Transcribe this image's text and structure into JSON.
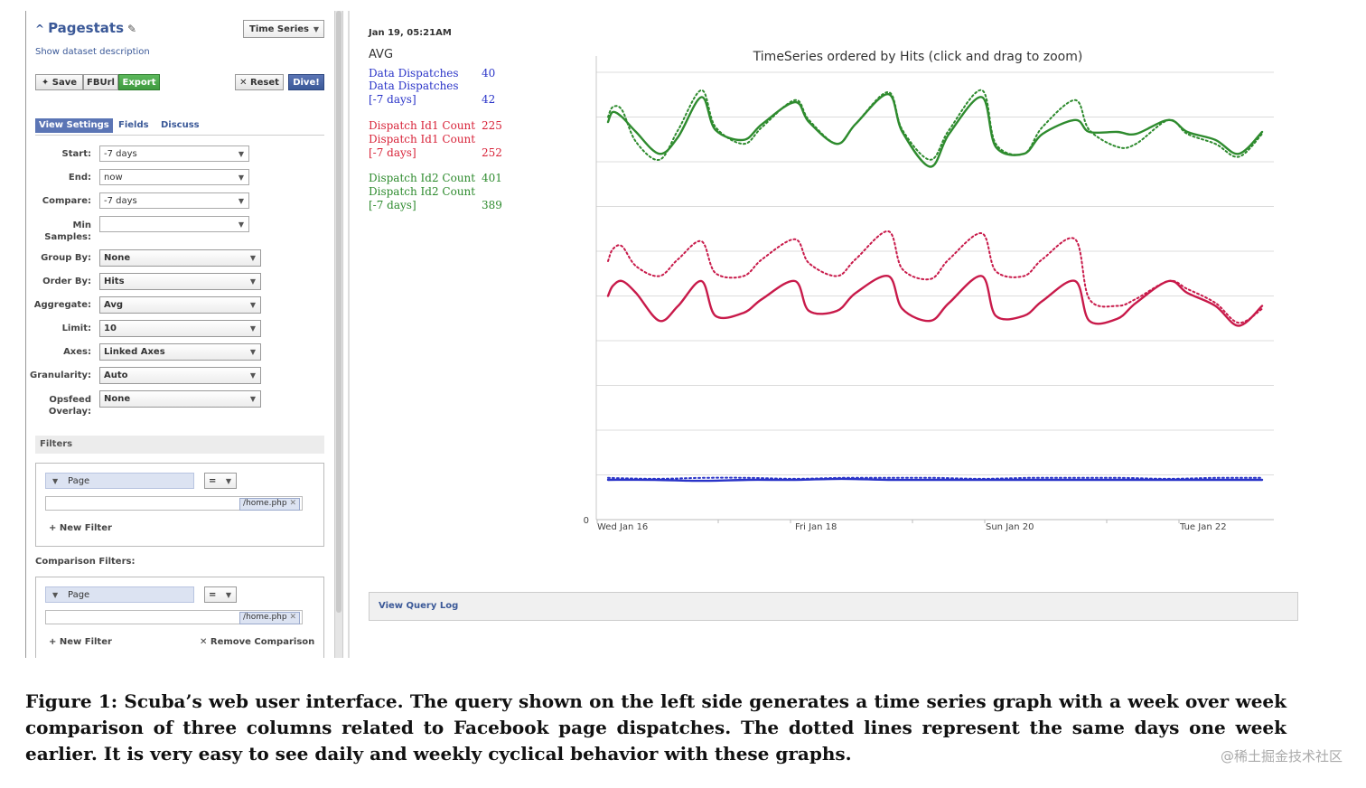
{
  "panel": {
    "title": "Pagestats",
    "show_description": "Show dataset description",
    "view_type": "Time Series",
    "buttons": {
      "save": "Save",
      "fburl": "FBUrl",
      "export": "Export",
      "reset": "Reset",
      "dive": "Dive!"
    },
    "tabs": {
      "view_settings": "View Settings",
      "fields": "Fields",
      "discuss": "Discuss"
    },
    "fields": {
      "start": {
        "label": "Start:",
        "value": "-7 days"
      },
      "end": {
        "label": "End:",
        "value": "now"
      },
      "compare": {
        "label": "Compare:",
        "value": "-7 days"
      },
      "min_samples": {
        "label1": "Min",
        "label2": "Samples:",
        "value": ""
      },
      "group_by": {
        "label": "Group By:",
        "value": "None"
      },
      "order_by": {
        "label": "Order By:",
        "value": "Hits"
      },
      "aggregate": {
        "label": "Aggregate:",
        "value": "Avg"
      },
      "limit": {
        "label": "Limit:",
        "value": "10"
      },
      "axes": {
        "label": "Axes:",
        "value": "Linked Axes"
      },
      "granularity": {
        "label": "Granularity:",
        "value": "Auto"
      },
      "opsfeed": {
        "label1": "Opsfeed",
        "label2": "Overlay:",
        "value": "None"
      }
    },
    "filters": {
      "title": "Filters",
      "field": "Page",
      "operator": "=",
      "token": "/home.php",
      "new_filter": "New Filter"
    },
    "comparison_filters": {
      "title": "Comparison Filters:",
      "field": "Page",
      "operator": "=",
      "token": "/home.php",
      "new_filter": "New Filter",
      "remove": "Remove Comparison"
    }
  },
  "legend": {
    "date": "Jan 19, 05:21AM",
    "aggregate": "AVG",
    "entries": [
      {
        "lines": [
          "Data Dispatches"
        ],
        "value": "40",
        "color": "#2a34c8"
      },
      {
        "lines": [
          "Data Dispatches",
          "[-7 days]"
        ],
        "value": "42",
        "color": "#2a34c8"
      },
      {
        "lines": [
          "Dispatch Id1 Count"
        ],
        "value": "225",
        "color": "#d8243a"
      },
      {
        "lines": [
          "Dispatch Id1 Count",
          "[-7 days]"
        ],
        "value": "252",
        "color": "#d8243a"
      },
      {
        "lines": [
          "Dispatch Id2 Count"
        ],
        "value": "401",
        "color": "#2e8b2e"
      },
      {
        "lines": [
          "Dispatch Id2 Count",
          "[-7 days]"
        ],
        "value": "389",
        "color": "#2e8b2e"
      }
    ]
  },
  "chart_data": {
    "type": "line",
    "title": "TimeSeries ordered by Hits (click and drag to zoom)",
    "x_tick_labels": [
      "Wed Jan 16",
      "Fri Jan 18",
      "Sun Jan 20",
      "Tue Jan 22"
    ],
    "y_tick_labels": [
      "0"
    ],
    "ylim": [
      0,
      450
    ],
    "grid": true,
    "series": [
      {
        "name": "Data Dispatches",
        "color": "#2a34c8",
        "style": "solid",
        "x": [
          0,
          0.5,
          1,
          1.5,
          2,
          2.5,
          3,
          3.5,
          4,
          4.5,
          5,
          5.5,
          6,
          6.5,
          7
        ],
        "y": [
          40,
          40,
          39,
          40,
          40,
          41,
          40,
          40,
          40,
          40,
          40,
          40,
          40,
          40,
          40
        ]
      },
      {
        "name": "Data Dispatches [-7 days]",
        "color": "#2a34c8",
        "style": "dotted",
        "x": [
          0,
          0.5,
          1,
          1.5,
          2,
          2.5,
          3,
          3.5,
          4,
          4.5,
          5,
          5.5,
          6,
          6.5,
          7
        ],
        "y": [
          42,
          41,
          42,
          42,
          41,
          42,
          42,
          42,
          41,
          42,
          42,
          42,
          41,
          42,
          42
        ]
      },
      {
        "name": "Dispatch Id1 Count",
        "color": "#c81a4a",
        "style": "solid",
        "x": [
          0,
          0.05,
          0.15,
          0.3,
          0.55,
          0.75,
          1.0,
          1.15,
          1.45,
          1.65,
          2.0,
          2.15,
          2.45,
          2.65,
          3.0,
          3.15,
          3.45,
          3.65,
          4.0,
          4.15,
          4.45,
          4.65,
          5.0,
          5.15,
          5.45,
          5.65,
          6.0,
          6.2,
          6.5,
          6.75,
          7.0
        ],
        "y": [
          225,
          235,
          240,
          228,
          200,
          215,
          240,
          205,
          208,
          222,
          240,
          210,
          210,
          228,
          245,
          212,
          200,
          218,
          245,
          205,
          205,
          220,
          240,
          200,
          202,
          218,
          240,
          228,
          215,
          195,
          215
        ]
      },
      {
        "name": "Dispatch Id1 Count [-7 days]",
        "color": "#c81a4a",
        "style": "dotted",
        "x": [
          0,
          0.05,
          0.15,
          0.3,
          0.55,
          0.75,
          1.0,
          1.15,
          1.45,
          1.65,
          2.0,
          2.15,
          2.45,
          2.65,
          3.0,
          3.15,
          3.45,
          3.65,
          4.0,
          4.15,
          4.45,
          4.65,
          5.0,
          5.15,
          5.45,
          5.65,
          6.0,
          6.2,
          6.5,
          6.75,
          7.0
        ],
        "y": [
          260,
          272,
          275,
          255,
          245,
          262,
          280,
          248,
          245,
          262,
          282,
          258,
          245,
          262,
          290,
          252,
          242,
          262,
          288,
          250,
          245,
          262,
          282,
          222,
          215,
          222,
          240,
          232,
          218,
          198,
          212
        ]
      },
      {
        "name": "Dispatch Id2 Count",
        "color": "#2e8b2e",
        "style": "solid",
        "x": [
          0,
          0.05,
          0.15,
          0.3,
          0.55,
          0.75,
          1.0,
          1.15,
          1.45,
          1.65,
          2.0,
          2.15,
          2.45,
          2.65,
          3.0,
          3.15,
          3.45,
          3.65,
          4.0,
          4.15,
          4.45,
          4.65,
          5.0,
          5.15,
          5.45,
          5.65,
          6.0,
          6.2,
          6.5,
          6.75,
          7.0
        ],
        "y": [
          400,
          410,
          405,
          390,
          368,
          385,
          425,
          392,
          382,
          398,
          420,
          400,
          378,
          398,
          428,
          390,
          355,
          388,
          425,
          375,
          368,
          388,
          402,
          390,
          390,
          388,
          402,
          390,
          382,
          368,
          390
        ]
      },
      {
        "name": "Dispatch Id2 Count [-7 days]",
        "color": "#2e8b2e",
        "style": "dotted",
        "x": [
          0,
          0.05,
          0.15,
          0.3,
          0.55,
          0.75,
          1.0,
          1.15,
          1.45,
          1.65,
          2.0,
          2.15,
          2.45,
          2.65,
          3.0,
          3.15,
          3.45,
          3.65,
          4.0,
          4.15,
          4.45,
          4.65,
          5.0,
          5.15,
          5.45,
          5.65,
          6.0,
          6.2,
          6.5,
          6.75,
          7.0
        ],
        "y": [
          405,
          415,
          412,
          380,
          362,
          392,
          432,
          395,
          378,
          395,
          422,
          402,
          378,
          398,
          430,
          392,
          362,
          392,
          432,
          378,
          368,
          395,
          422,
          392,
          375,
          378,
          402,
          388,
          378,
          365,
          388
        ]
      }
    ]
  },
  "query_log": "View Query Log",
  "caption": "Figure 1:  Scuba’s web user interface.  The query shown on the left side generates a time series graph with a week over week comparison of three columns related to Facebook page dispatches.  The dotted lines represent the same days one week earlier.  It is very easy to see daily and weekly cyclical behavior with these graphs.",
  "watermark": "@稀土掘金技术社区"
}
